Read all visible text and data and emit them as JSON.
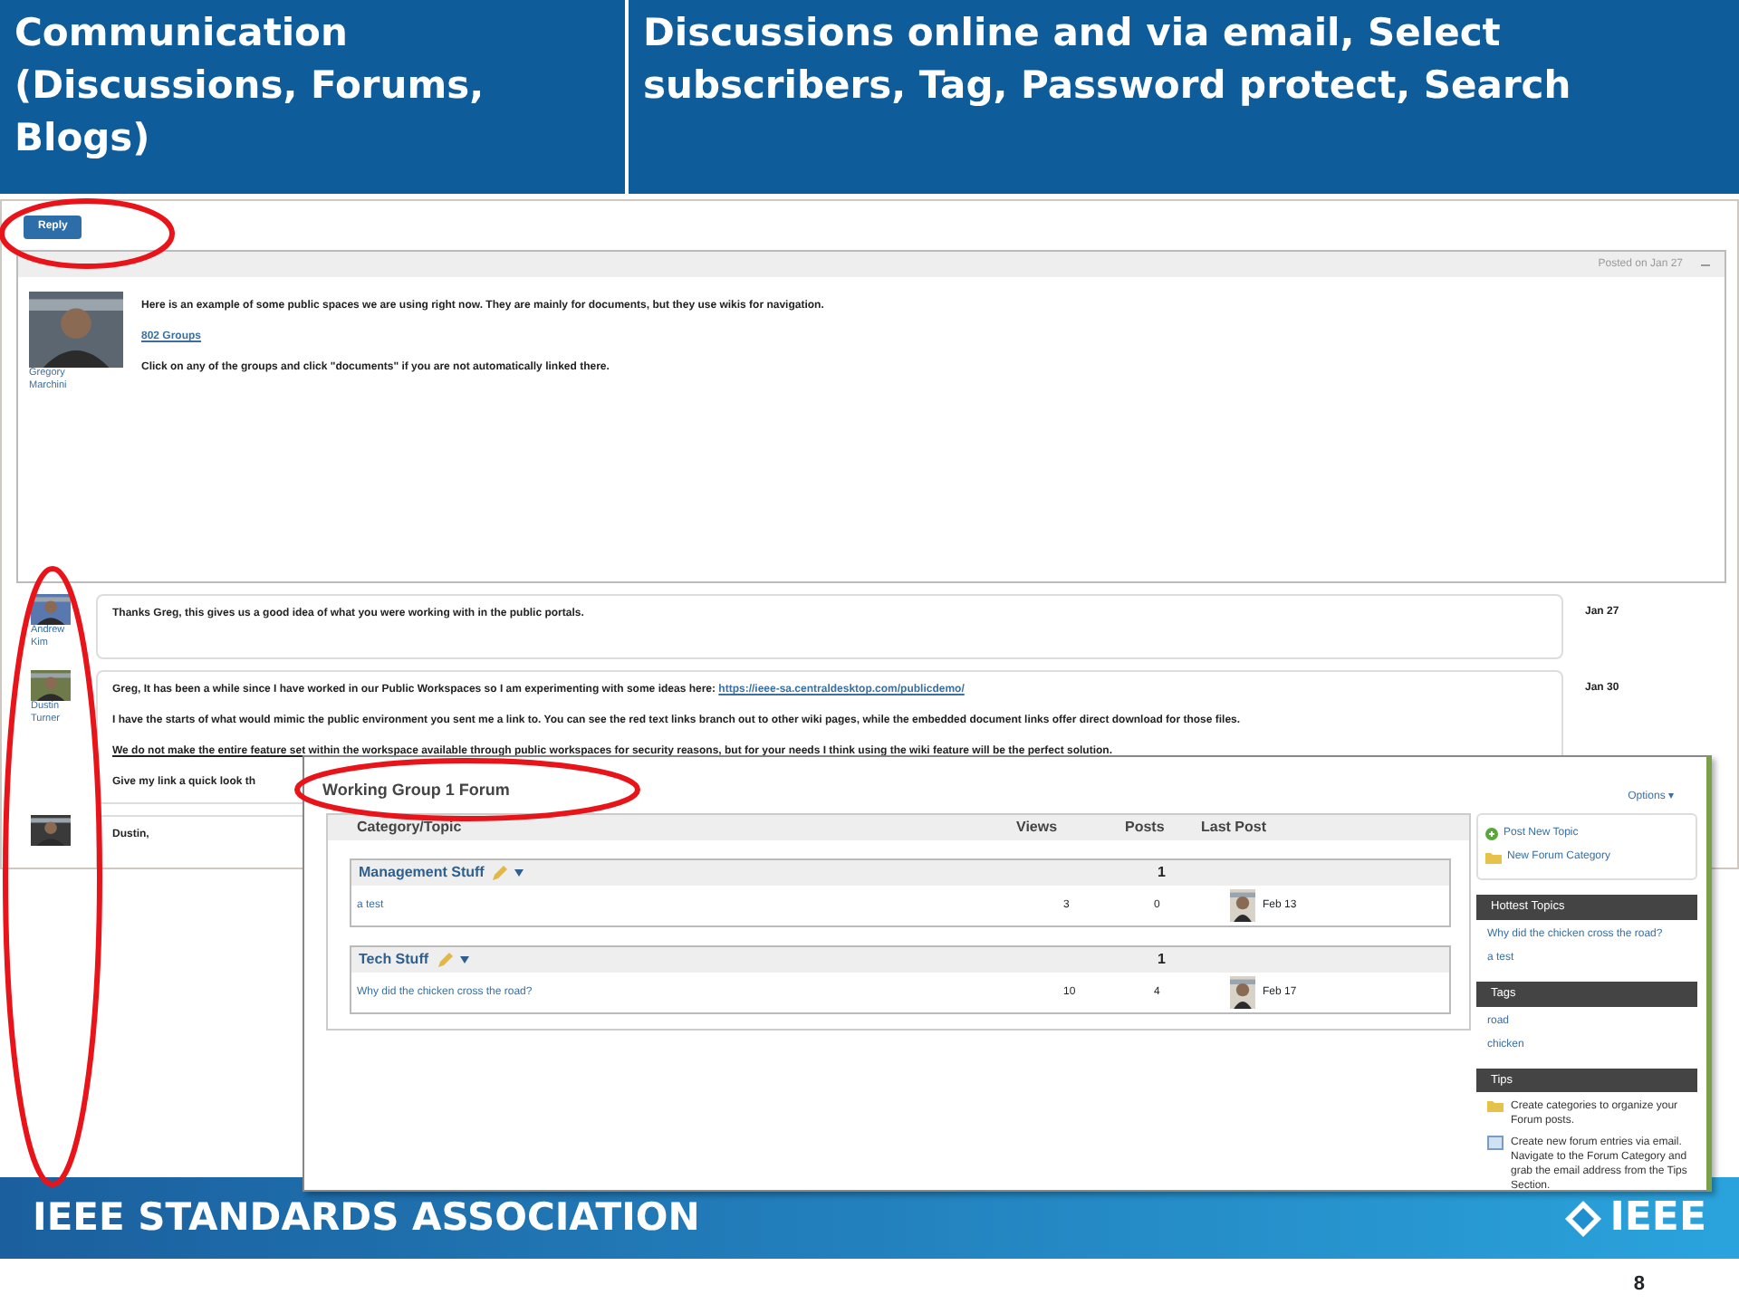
{
  "header": {
    "cells": [
      "Communication (Discussions, Forums, Blogs)",
      "Discussions online and via email, Select subscribers, Tag, Password protect, Search"
    ]
  },
  "discussion": {
    "reply_button": "Reply",
    "post": {
      "posted": "Posted on Jan 27",
      "author": "Gregory Marchini",
      "lines": [
        {
          "kind": "text",
          "text": "Here is an example of some public spaces we are using right now. They are mainly for documents, but they use wikis for navigation."
        },
        {
          "kind": "link",
          "text": "802 Groups"
        },
        {
          "kind": "text",
          "text": "Click on any of the groups and click \"documents\" if you are not automatically linked there."
        }
      ]
    },
    "replies": [
      {
        "author": "Andrew Kim",
        "date": "Jan 27",
        "lines": [
          {
            "text": "Thanks Greg, this gives us a good idea of what you were working with in the public portals.",
            "underlined": false
          }
        ]
      },
      {
        "author": "Dustin Turner",
        "date": "Jan 30",
        "lines": [
          {
            "text": "Greg, It has been a while since I have worked in our Public Workspaces so I am experimenting with some ideas here: ",
            "link": "https://ieee-sa.centraldesktop.com/publicdemo/",
            "underlined": false
          },
          {
            "text": "I have the starts of what would mimic the public environment you sent me a link to. You can see the red text links branch out to other wiki pages, while the embedded document links offer direct download for those files.",
            "underlined": false
          },
          {
            "text": "We do not make the entire feature set within the workspace available through public workspaces for security reasons, but for your needs I think using the wiki feature will be the perfect solution.",
            "underlined": true
          },
          {
            "text": "Give my link a quick look th",
            "underlined": false
          }
        ]
      },
      {
        "lines": [
          {
            "text": "Dustin,",
            "underlined": false
          }
        ]
      }
    ]
  },
  "forum": {
    "title": "Working Group 1 Forum",
    "options": "Options ▾",
    "columns": [
      "Category/Topic",
      "Views",
      "Posts",
      "Last Post"
    ],
    "categories": [
      {
        "name": "Management Stuff",
        "count": "1",
        "topics": [
          {
            "title": "a test",
            "views": "3",
            "posts": "0",
            "last_post": "Feb 13"
          }
        ]
      },
      {
        "name": "Tech Stuff",
        "count": "1",
        "topics": [
          {
            "title": "Why did the chicken cross the road?",
            "views": "10",
            "posts": "4",
            "last_post": "Feb 17"
          }
        ]
      }
    ],
    "actions": [
      {
        "kind": "add",
        "label": "Post New Topic"
      },
      {
        "kind": "folder",
        "label": "New Forum Category"
      }
    ],
    "sections": [
      {
        "title": "Hottest Topics",
        "kind": "links",
        "items": [
          "Why did the chicken cross the road?",
          "a test"
        ]
      },
      {
        "title": "Tags",
        "kind": "links",
        "items": [
          "road",
          "chicken"
        ]
      },
      {
        "title": "Tips",
        "kind": "tips",
        "items": [
          {
            "kind": "folder",
            "text": "Create categories to organize your Forum posts."
          },
          {
            "kind": "mail",
            "text": "Create new forum entries via email. Navigate to the Forum Category and grab the email address from the Tips Section."
          }
        ]
      }
    ]
  },
  "footer": {
    "organization": "IEEE STANDARDS ASSOCIATION",
    "logo": "IEEE",
    "page_number": "8"
  }
}
